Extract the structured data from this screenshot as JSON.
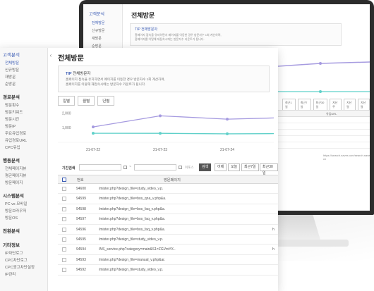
{
  "colors": {
    "accent": "#3a5bb4",
    "series_purple": "#a69be0",
    "series_teal": "#5fd0c9"
  },
  "back": {
    "sidebar": {
      "category": "고객분석",
      "items": [
        "전체방문",
        "신규방문",
        "재방문",
        "순방문"
      ]
    },
    "title": "전체방문",
    "tip": {
      "title": "TIP 전체방문자",
      "body1": "홈페이지 접속을 유지하면서 페이지를 이동한 경우 방문자수 1회 계산하며,",
      "body2": "홈페이지를 이탈해 재접속시에는 방문자수 카운트가 됩니다."
    },
    "tabs": [
      "일별",
      "월별",
      "년별"
    ],
    "filters": [
      "최근1일",
      "최근7일",
      "최근30일",
      "지난주",
      "지난달",
      "지난달"
    ],
    "column": "유입URL",
    "link": "https://search.naver.com/search.naver?cn"
  },
  "sidebar": {
    "groups": [
      {
        "title": "고객분석",
        "highlight": true,
        "items": [
          "전체방문",
          "신규방문",
          "재방문",
          "순방문"
        ],
        "active": 0
      },
      {
        "title": "경로분석",
        "highlight": false,
        "items": [
          "방문횟수",
          "방문키워드",
          "방문시간",
          "방문IP",
          "주요유입경로",
          "유입경로URL",
          "CPC유입"
        ]
      },
      {
        "title": "행동분석",
        "highlight": false,
        "items": [
          "전체페이지뷰",
          "평균페이지뷰",
          "방문페이지"
        ]
      },
      {
        "title": "시스템분석",
        "highlight": false,
        "items": [
          "PC vs 모바일",
          "방문브라우저",
          "방문OS"
        ]
      },
      {
        "title": "전환분석",
        "highlight": false,
        "items": []
      },
      {
        "title": "기타정보",
        "highlight": false,
        "items": [
          "IP차단로그",
          "CPC차단로그",
          "CPC광고차단설정",
          "IP관리"
        ]
      }
    ]
  },
  "main": {
    "title": "전체방문",
    "tip": {
      "label": "TIP",
      "title": "전체방문자",
      "line1": "홈페이지 접속을 유지하면서 페이지를 이동한 경우 방문자수 1회 계산하며,",
      "line2": "홈페이지를 이탈해 재접속시에는 방문자수 카운트가 됩니다."
    },
    "tabs": [
      "일별",
      "월별",
      "년별"
    ],
    "filter": {
      "label": "기간검색",
      "range_sep": "~",
      "search_btn": "검색",
      "quick": [
        "어제",
        "오늘",
        "최근7일",
        "최근30일"
      ],
      "hidden_label": "미포스"
    },
    "table": {
      "headers": [
        "번호",
        "방문페이지"
      ],
      "rows": [
        {
          "no": "94600",
          "page": "/mister.php?design_file=study_video_v.p.",
          "extra": ""
        },
        {
          "no": "94599",
          "page": "/mister.php?design_file=bos_qna_v.php&a.",
          "extra": ""
        },
        {
          "no": "94598",
          "page": "/mister.php?design_file=bos_faq_v.php&a.",
          "extra": ""
        },
        {
          "no": "94597",
          "page": "/mister.php?design_file=bos_faq_v.php&a.",
          "extra": ""
        },
        {
          "no": "94596",
          "page": "/mister.php?design_file=bos_faq_v.php&a.",
          "extra": "h"
        },
        {
          "no": "94595",
          "page": "/mister.php?design_file=study_video_v.p.",
          "extra": ""
        },
        {
          "no": "94594",
          "page": "/NS_service.php?category=main&S1=ZGVmYX..",
          "extra": "h"
        },
        {
          "no": "94593",
          "page": "/mister.php?design_file=manual_v.php&ar.",
          "extra": ""
        },
        {
          "no": "94592",
          "page": "/mister.php?design_file=study_video_v.p.",
          "extra": ""
        }
      ]
    }
  },
  "chart_data": {
    "type": "line",
    "categories": [
      "21-07-22",
      "21-07-23",
      "21-07-24"
    ],
    "y_ticks": [
      "2,000",
      "1,000"
    ],
    "ylim": [
      0,
      2500
    ],
    "series": [
      {
        "values": [
          1050,
          1810,
          1580,
          1700
        ]
      },
      {
        "values": [
          620,
          615,
          580,
          600
        ]
      }
    ]
  }
}
